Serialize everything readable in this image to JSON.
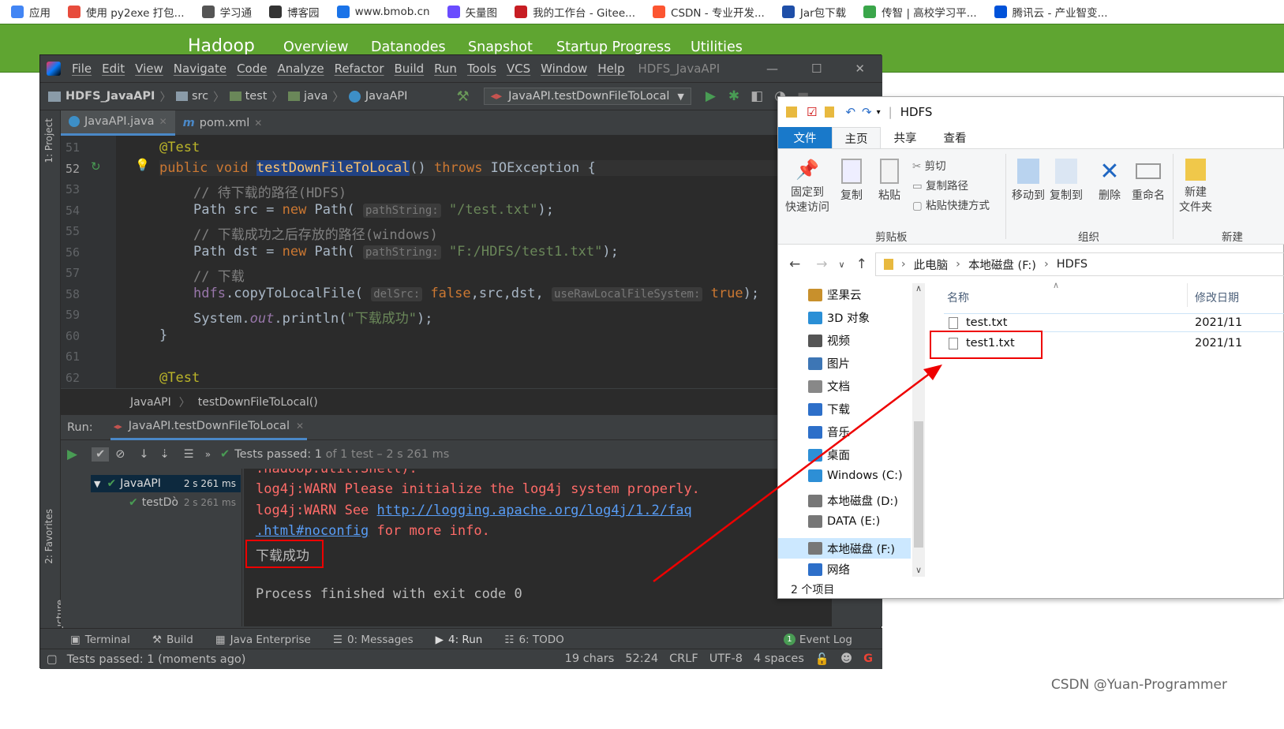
{
  "bookmarks": [
    {
      "label": "应用",
      "color": "#4285f4"
    },
    {
      "label": "使用 py2exe 打包...",
      "color": "#e74c3c"
    },
    {
      "label": "学习通",
      "color": "#555555"
    },
    {
      "label": "博客园",
      "color": "#333333"
    },
    {
      "label": "www.bmob.cn",
      "color": "#1a73e8"
    },
    {
      "label": "矢量图",
      "color": "#6a4cff"
    },
    {
      "label": "我的工作台 - Gitee...",
      "color": "#c71d23"
    },
    {
      "label": "CSDN - 专业开发...",
      "color": "#fc5531"
    },
    {
      "label": "Jar包下载",
      "color": "#1f4fa8"
    },
    {
      "label": "传智 | 高校学习平...",
      "color": "#3aa64a"
    },
    {
      "label": "腾讯云 - 产业智变...",
      "color": "#0052d9"
    }
  ],
  "hadoop": {
    "brand": "Hadoop",
    "items": [
      "Overview",
      "Datanodes",
      "Snapshot",
      "Startup Progress",
      "Utilities"
    ]
  },
  "ide": {
    "menu": [
      "File",
      "Edit",
      "View",
      "Navigate",
      "Code",
      "Analyze",
      "Refactor",
      "Build",
      "Run",
      "Tools",
      "VCS",
      "Window",
      "Help"
    ],
    "project_title": "HDFS_JavaAPI",
    "nav": [
      "HDFS_JavaAPI",
      "src",
      "test",
      "java",
      "JavaAPI"
    ],
    "run_config": "JavaAPI.testDownFileToLocal",
    "tabs": [
      "JavaAPI.java",
      "pom.xml"
    ],
    "side_left": [
      "1: Project",
      "2: Favorites",
      "Z: Structure"
    ],
    "line_numbers": [
      "51",
      "52",
      "53",
      "54",
      "55",
      "56",
      "57",
      "58",
      "59",
      "60",
      "61",
      "62"
    ],
    "code": {
      "l51": "@Test",
      "l52a": "public void ",
      "l52fn": "testDownFileToLocal",
      "l52b": "() ",
      "l52kw": "throws",
      "l52c": " IOException {",
      "l53": "// 待下载的路径(HDFS)",
      "l54a": "Path src = ",
      "l54kw": "new",
      "l54b": " Path( ",
      "l54h": "pathString:",
      "l54s": " \"/test.txt\"",
      "l54c": ");",
      "l55": "// 下载成功之后存放的路径(windows)",
      "l56a": "Path dst = ",
      "l56kw": "new",
      "l56b": " Path( ",
      "l56h": "pathString:",
      "l56s": " \"F:/HDFS/test1.txt\"",
      "l56c": ");",
      "l57": "// 下载",
      "l58a": "hdfs",
      "l58b": ".copyToLocalFile( ",
      "l58h1": "delSrc:",
      "l58k1": " false",
      ",l58c": ",src,dst, ",
      "l58c": ",src,dst, ",
      "l58h2": "useRawLocalFileSystem:",
      "l58k2": " true",
      "l58d": ");",
      "l59a": "System.",
      "l59f": "out",
      "l59b": ".println(",
      "l59s": "\"下载成功\"",
      "l59c": ");",
      "l60": "}",
      "l62": "@Test"
    },
    "breadcrumb": [
      "JavaAPI",
      "testDownFileToLocal()"
    ],
    "run_label": "Run:",
    "run_tab": "JavaAPI.testDownFileToLocal",
    "tests_passed": "Tests passed:",
    "tests_count": "1",
    "tests_of": "of 1 test – 2 s 261 ms",
    "tree": [
      {
        "name": "JavaAPI",
        "time": "2 s 261 ms"
      },
      {
        "name": "testDò",
        "time": "2 s 261 ms"
      }
    ],
    "console": [
      ".hadoop.util.Shell).",
      "log4j:WARN Please initialize the log4j system properly.",
      "log4j:WARN See ",
      "http://logging.apache.org/log4j/1.2/faq",
      ".html#noconfig",
      " for more info.",
      "下载成功",
      "Process finished with exit code 0"
    ],
    "bottom_tabs": [
      "Terminal",
      "Build",
      "Java Enterprise",
      "0: Messages",
      "4: Run",
      "6: TODO"
    ],
    "event_log": "Event Log",
    "event_count": "1",
    "status_left": "Tests passed: 1 (moments ago)",
    "status_right": [
      "19 chars",
      "52:24",
      "CRLF",
      "UTF-8",
      "4 spaces"
    ]
  },
  "explorer": {
    "title": "HDFS",
    "tabs": [
      "文件",
      "主页",
      "共享",
      "查看"
    ],
    "ribbon": {
      "pin": "固定到\n快速访问",
      "copy": "复制",
      "paste": "粘贴",
      "cut": "剪切",
      "copy_path": "复制路径",
      "paste_shortcut": "粘贴快捷方式",
      "move_to": "移动到",
      "copy_to": "复制到",
      "delete": "删除",
      "rename": "重命名",
      "new_folder": "新建\n文件夹",
      "group_clipboard": "剪贴板",
      "group_organize": "组织",
      "group_new": "新建"
    },
    "address": [
      "此电脑",
      "本地磁盘 (F:)",
      "HDFS"
    ],
    "tree": [
      "坚果云",
      "3D 对象",
      "视频",
      "图片",
      "文档",
      "下载",
      "音乐",
      "桌面",
      "Windows (C:)",
      "本地磁盘 (D:)",
      "DATA (E:)",
      "本地磁盘 (F:)",
      "网络"
    ],
    "columns": [
      "名称",
      "修改日期"
    ],
    "files": [
      {
        "name": "test.txt",
        "date": "2021/11"
      },
      {
        "name": "test1.txt",
        "date": "2021/11"
      }
    ],
    "status": "2 个项目"
  },
  "watermark": "CSDN @Yuan-Programmer"
}
